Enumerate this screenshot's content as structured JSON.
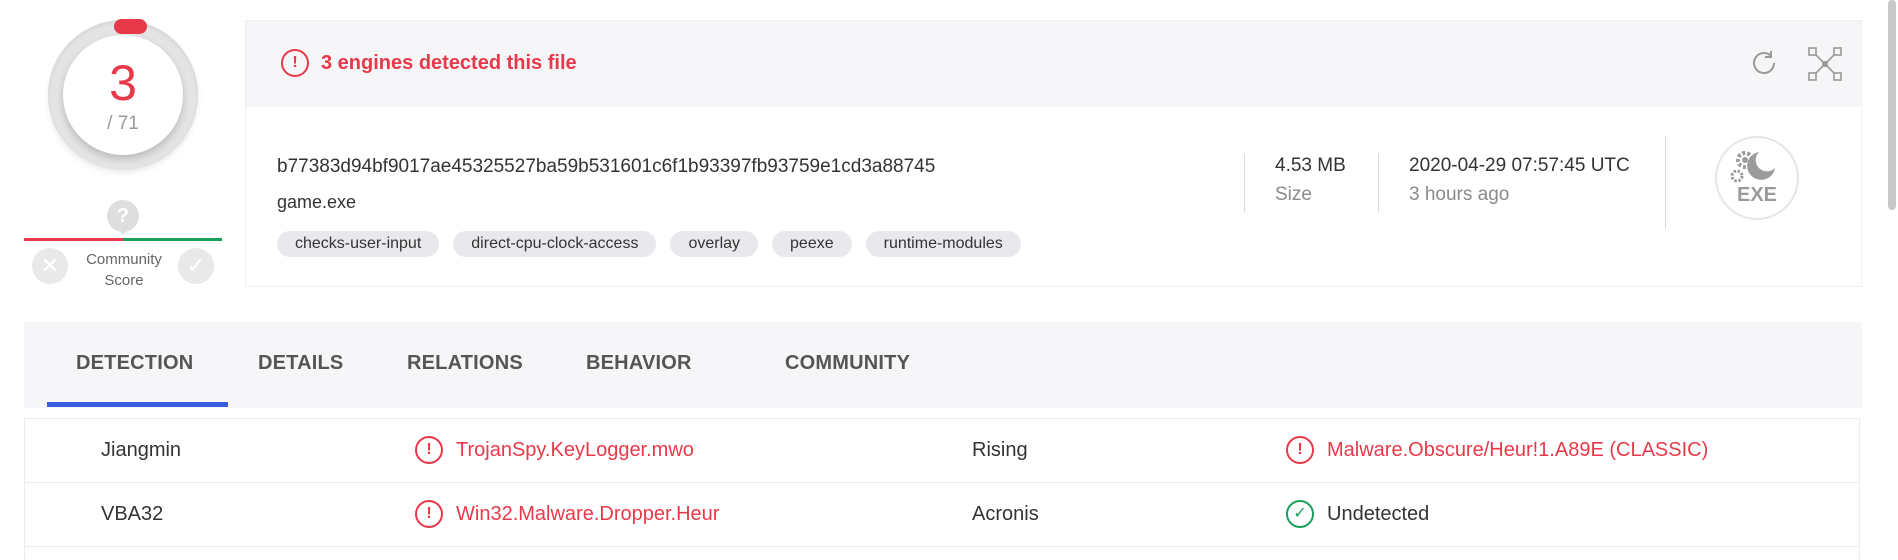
{
  "score": {
    "detections": "3",
    "total": "/ 71"
  },
  "community": {
    "question": "?",
    "label_line1": "Community",
    "label_line2": "Score",
    "downvote": "✕",
    "upvote": "✓"
  },
  "header": {
    "alert_glyph": "!",
    "alert_text": "3 engines detected this file"
  },
  "file": {
    "hash": "b77383d94bf9017ae45325527ba59b531601c6f1b93397fb93759e1cd3a88745",
    "name": "game.exe",
    "tags": [
      "checks-user-input",
      "direct-cpu-clock-access",
      "overlay",
      "peexe",
      "runtime-modules"
    ],
    "size_value": "4.53 MB",
    "size_label": "Size",
    "date_value": "2020-04-29 07:57:45 UTC",
    "date_relative": "3 hours ago",
    "type_label": "EXE"
  },
  "tabs": [
    {
      "label": "DETECTION",
      "active": true
    },
    {
      "label": "DETAILS"
    },
    {
      "label": "RELATIONS"
    },
    {
      "label": "BEHAVIOR"
    },
    {
      "label": "COMMUNITY"
    }
  ],
  "detections": [
    {
      "left": {
        "engine": "Jiangmin",
        "result": "TrojanSpy.KeyLogger.mwo",
        "status": "malicious"
      },
      "right": {
        "engine": "Rising",
        "result": "Malware.Obscure/Heur!1.A89E (CLASSIC)",
        "status": "malicious"
      }
    },
    {
      "left": {
        "engine": "VBA32",
        "result": "Win32.Malware.Dropper.Heur",
        "status": "malicious"
      },
      "right": {
        "engine": "Acronis",
        "result": "Undetected",
        "status": "undetected"
      }
    }
  ],
  "colors": {
    "malicious": "#e8394a",
    "clean": "#1a9e5c",
    "accent": "#3b5de0"
  }
}
